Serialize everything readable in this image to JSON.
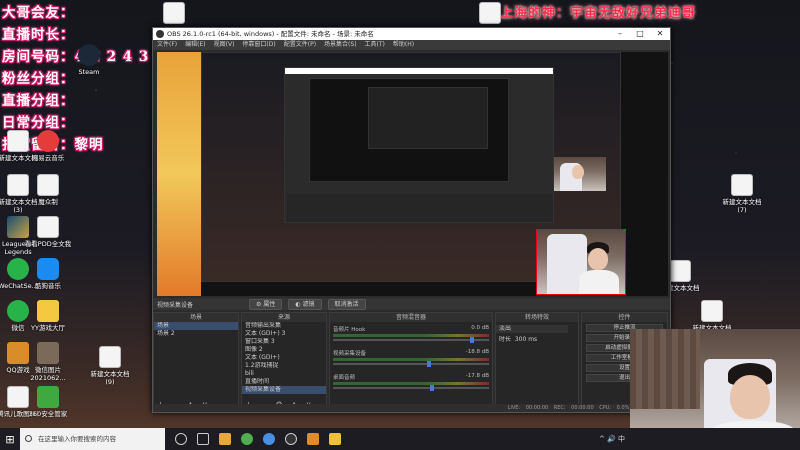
{
  "overlay": {
    "lines": [
      "大哥会友：",
      "直播时长：",
      "房间号码：4 2 2 4 3",
      "粉丝分组：",
      "直播分组：",
      "日常分组：",
      "打赏留言：黎明"
    ],
    "top_text": "上海的神：宇宙无敌好兄弟迪哥",
    "text_color": "#ffffff",
    "stroke_color": "#d21a6a",
    "top_color": "#ff2a4a"
  },
  "desktop_icons": [
    {
      "label": "新建文本文档",
      "icon": "document-icon"
    },
    {
      "label": "网易云音乐",
      "icon": "netease-music-icon"
    },
    {
      "label": "新建文本文档 (3)",
      "icon": "document-icon"
    },
    {
      "label": "魔众制",
      "icon": "document-icon"
    },
    {
      "label": "League of Legends",
      "icon": "league-of-legends-icon"
    },
    {
      "label": "看看PDD全文我",
      "icon": "document-icon"
    },
    {
      "label": "WeChatSe...",
      "icon": "wechat-icon"
    },
    {
      "label": "酷狗音乐",
      "icon": "kugou-icon"
    },
    {
      "label": "微信",
      "icon": "wechat-icon"
    },
    {
      "label": "YY游戏大厅",
      "icon": "yy-icon"
    },
    {
      "label": "QQ游戏",
      "icon": "qq-game-icon"
    },
    {
      "label": "微信图片 2021062...",
      "icon": "photo-icon"
    },
    {
      "label": "腾讯儿歌图(1)",
      "icon": "document-icon"
    },
    {
      "label": "360安全管家",
      "icon": "shield-icon"
    },
    {
      "label": "Steam",
      "icon": "steam-icon"
    },
    {
      "label": "新建文本文档 (8)",
      "icon": "document-icon"
    },
    {
      "label": "新建文本文档 (7)",
      "icon": "document-icon"
    },
    {
      "label": "新建文本文档",
      "icon": "document-icon"
    },
    {
      "label": "新建文本文档",
      "icon": "document-icon"
    },
    {
      "label": "新建文本文档 (9)",
      "icon": "document-icon"
    }
  ],
  "obs": {
    "title": "OBS 26.1.0-rc1 (64-bit, windows) - 配置文件: 未命名 - 场景: 未命名",
    "menu": [
      "文件(F)",
      "编辑(E)",
      "视图(V)",
      "停靠窗口(D)",
      "配置文件(P)",
      "场景集合(S)",
      "工具(T)",
      "帮助(H)"
    ],
    "ctx": {
      "source": "视频采集设备",
      "props": "属性",
      "filters": "滤镜",
      "deactivate": "取消激活"
    },
    "docks": {
      "scenes": {
        "header": "场景",
        "items": [
          "场景",
          "场景 2"
        ]
      },
      "sources": {
        "header": "来源",
        "items": [
          "音频输出采集",
          "文本 (GDI+) 3",
          "窗口采集 3",
          "图像 2",
          "文本 (GDI+)",
          "1.2游戏捕捉",
          "bili",
          "直播时间",
          "视频采集设备"
        ]
      },
      "mixer": {
        "header": "音频混音器",
        "channels": [
          {
            "name": "音频片 Hook",
            "db": "0.0 dB"
          },
          {
            "name": "视频采集设备",
            "db": "-18.8 dB"
          },
          {
            "name": "桌面音频",
            "db": "-17.8 dB"
          }
        ]
      },
      "transitions": {
        "header": "转场特效",
        "type": "淡出",
        "duration_label": "时长",
        "duration": "300 ms"
      },
      "controls": {
        "header": "控件",
        "buttons": [
          "停止推流",
          "开始录制",
          "启动虚拟摄像机",
          "工作室模式",
          "设置",
          "退出"
        ]
      }
    },
    "status": "LIVE: 00:00:00   REC: 00:00:00   CPU: 0.0%, 60.00 fps"
  },
  "taskbar": {
    "search_placeholder": "在这里输入你要搜索的内容",
    "clock": "^ 🔊 中"
  }
}
